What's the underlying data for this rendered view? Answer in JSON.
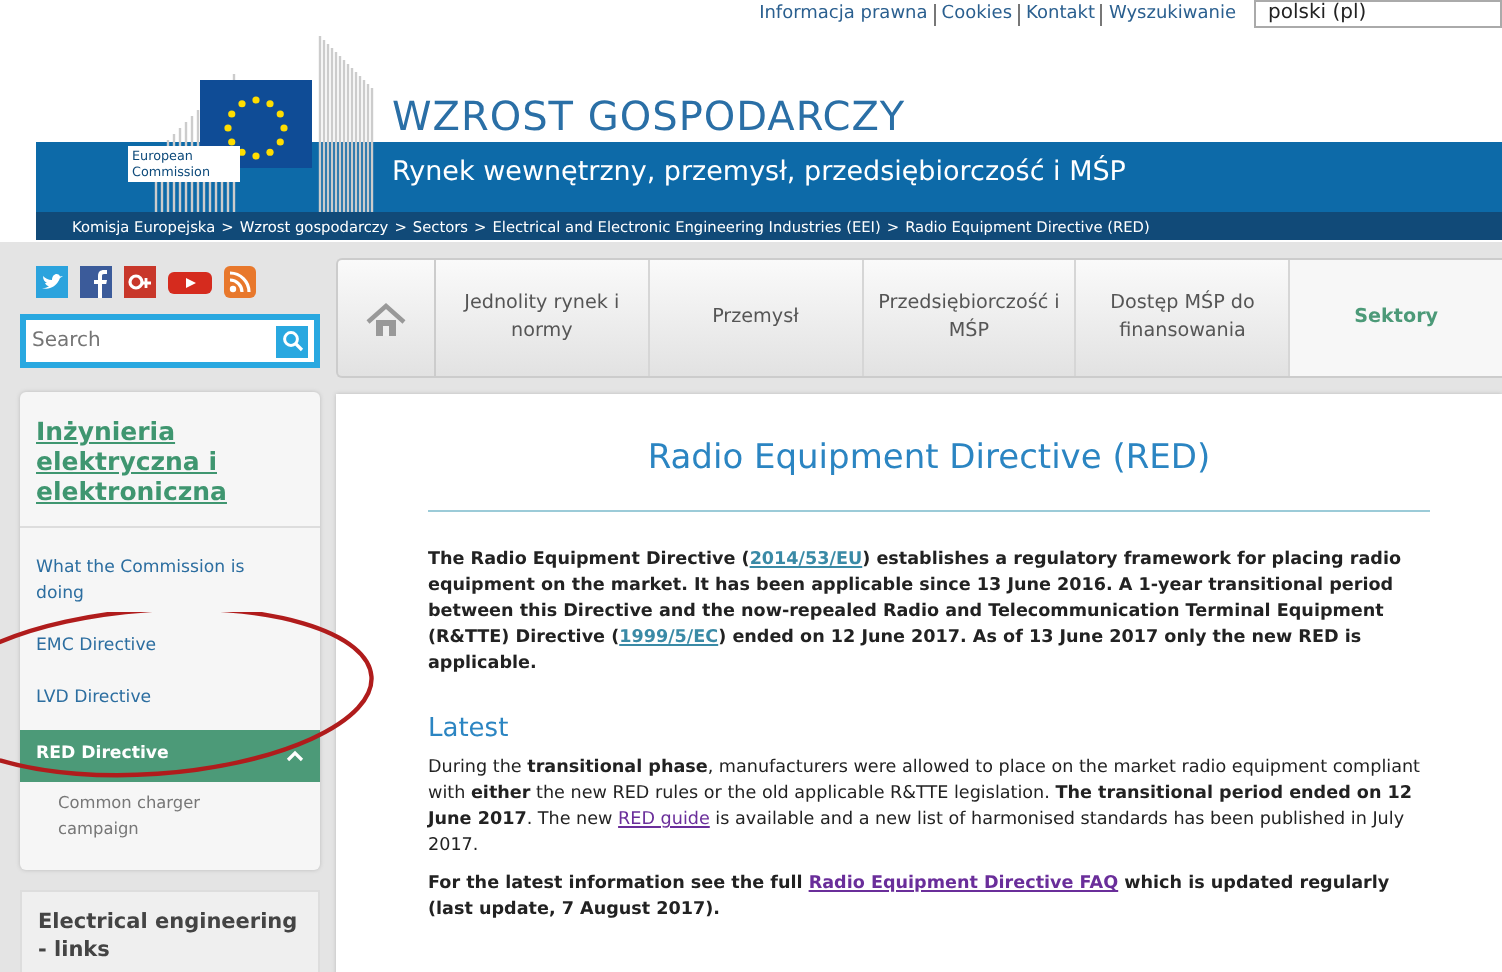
{
  "top_links": [
    "Informacja prawna",
    "Cookies",
    "Kontakt",
    "Wyszukiwanie"
  ],
  "language_select": {
    "value": "polski (pl)"
  },
  "logo": {
    "caption": "European Commission"
  },
  "site_title": "WZROST GOSPODARCZY",
  "site_subtitle": "Rynek wewnętrzny, przemysł, przedsiębiorczość i MŚP",
  "breadcrumb": {
    "separator": ">",
    "items": [
      "Komisja Europejska",
      "Wzrost gospodarczy",
      "Sectors",
      "Electrical and Electronic Engineering Industries (EEI)",
      "Radio Equipment Directive (RED)"
    ]
  },
  "search": {
    "placeholder": "Search"
  },
  "nav": [
    {
      "label": "Jednolity rynek i normy",
      "selected": false
    },
    {
      "label": "Przemysł",
      "selected": false
    },
    {
      "label": "Przedsiębiorczość i MŚP",
      "selected": false
    },
    {
      "label": "Dostęp MŚP do finansowania",
      "selected": false
    },
    {
      "label": "Sektory",
      "selected": true
    }
  ],
  "sidebar": {
    "title": "Inżynieria elektryczna i elektroniczna",
    "items": [
      {
        "label": "What the Commission is doing",
        "selected": false
      },
      {
        "label": "EMC Directive",
        "selected": false
      },
      {
        "label": "LVD Directive",
        "selected": false
      },
      {
        "label": "RED Directive",
        "selected": true,
        "expanded": true,
        "children": [
          {
            "label": "Common charger campaign",
            "selected": false
          }
        ]
      }
    ]
  },
  "links_box": {
    "title": "Electrical engineering - links"
  },
  "content": {
    "title": "Radio Equipment Directive (RED)",
    "intro": {
      "bold": true,
      "segments": [
        {
          "kind": "text",
          "text": "The Radio Equipment Directive ("
        },
        {
          "kind": "link",
          "text": "2014/53/EU",
          "visited": false
        },
        {
          "kind": "text",
          "text": ") establishes a regulatory framework for placing radio equipment on the market. It has been applicable since 13 June 2016. A 1-year transitional period between this Directive and the now-repealed Radio and Telecommunication Terminal Equipment (R&TTE) Directive ("
        },
        {
          "kind": "link",
          "text": "1999/5/EC",
          "visited": false
        },
        {
          "kind": "text",
          "text": ") ended on 12 June 2017. As of 13 June 2017 only the new RED is applicable."
        }
      ]
    },
    "sections": [
      {
        "heading": "Latest",
        "paragraphs": [
          {
            "bold": false,
            "segments": [
              {
                "kind": "text",
                "text": "During the **transitional phase**, manufacturers were allowed to place on the market radio equipment compliant with **either** the new RED rules or the old applicable R&TTE legislation. **The transitional period ended on 12 June 2017**. The new "
              },
              {
                "kind": "link",
                "text": "RED guide",
                "visited": true
              },
              {
                "kind": "text",
                "text": " is available and a new list of harmonised standards has been published in July 2017."
              }
            ]
          },
          {
            "bold": true,
            "segments": [
              {
                "kind": "text",
                "text": "For the latest information see the full "
              },
              {
                "kind": "link",
                "text": "Radio Equipment Directive FAQ",
                "visited": true
              },
              {
                "kind": "text",
                "text": " which is updated regularly (last update, 7 August 2017)."
              }
            ]
          }
        ]
      }
    ]
  },
  "annotation": {
    "kind": "ellipse",
    "color": "#b01c1c"
  }
}
